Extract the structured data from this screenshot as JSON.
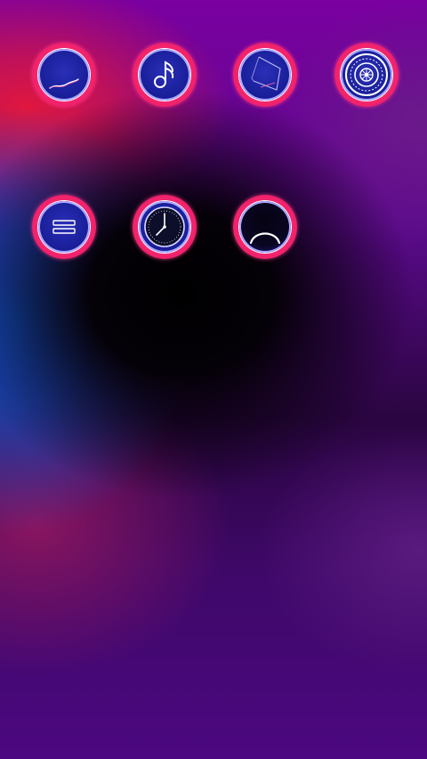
{
  "home_screen": {
    "icons": [
      {
        "name": "app-icon-gallery",
        "glyph": "wave-line-icon"
      },
      {
        "name": "app-icon-music",
        "glyph": "music-note-icon"
      },
      {
        "name": "app-icon-notes",
        "glyph": "folded-page-icon"
      },
      {
        "name": "app-icon-compass",
        "glyph": "ornate-dial-icon"
      },
      {
        "name": "app-icon-menu",
        "glyph": "hamburger-lines-icon"
      },
      {
        "name": "app-icon-clock",
        "glyph": "clock-icon"
      },
      {
        "name": "app-icon-arc",
        "glyph": "arc-icon"
      }
    ],
    "colors": {
      "ring": "#f0206a",
      "ring_glow": "#ff4a88",
      "inner": "#1a1f9a",
      "inner_border": "#a8a8ff",
      "glyph": "#ffffff",
      "wallpaper_red": "#e0173f",
      "wallpaper_blue": "#1352c8",
      "wallpaper_purple": "#4a0a78",
      "wallpaper_dark": "#000000"
    }
  }
}
